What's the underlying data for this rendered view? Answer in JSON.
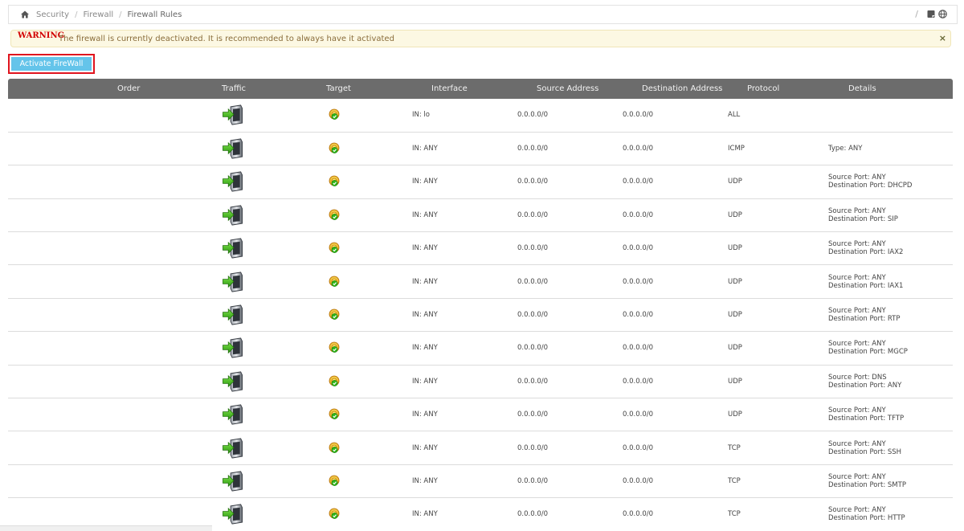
{
  "breadcrumb": {
    "items": [
      "Security",
      "Firewall",
      "Firewall Rules"
    ],
    "separator": "/"
  },
  "toolbar": {
    "slash": "/",
    "icons": [
      "note-icon",
      "globe-icon"
    ]
  },
  "warning": {
    "label": "WARNING",
    "message": "The firewall is currently deactivated. It is recommended to always have it activated",
    "close": "×"
  },
  "activate_button": {
    "label": "Activate FireWall"
  },
  "table": {
    "headers": [
      "Order",
      "Traffic",
      "Target",
      "Interface",
      "Source Address",
      "Destination Address",
      "Protocol",
      "Details"
    ],
    "rows": [
      {
        "interface": "IN: lo",
        "source": "0.0.0.0/0",
        "destination": "0.0.0.0/0",
        "protocol": "ALL",
        "details": []
      },
      {
        "interface": "IN: ANY",
        "source": "0.0.0.0/0",
        "destination": "0.0.0.0/0",
        "protocol": "ICMP",
        "details": [
          "Type: ANY"
        ]
      },
      {
        "interface": "IN: ANY",
        "source": "0.0.0.0/0",
        "destination": "0.0.0.0/0",
        "protocol": "UDP",
        "details": [
          "Source Port: ANY",
          "Destination Port: DHCPD"
        ]
      },
      {
        "interface": "IN: ANY",
        "source": "0.0.0.0/0",
        "destination": "0.0.0.0/0",
        "protocol": "UDP",
        "details": [
          "Source Port: ANY",
          "Destination Port: SIP"
        ]
      },
      {
        "interface": "IN: ANY",
        "source": "0.0.0.0/0",
        "destination": "0.0.0.0/0",
        "protocol": "UDP",
        "details": [
          "Source Port: ANY",
          "Destination Port: IAX2"
        ]
      },
      {
        "interface": "IN: ANY",
        "source": "0.0.0.0/0",
        "destination": "0.0.0.0/0",
        "protocol": "UDP",
        "details": [
          "Source Port: ANY",
          "Destination Port: IAX1"
        ]
      },
      {
        "interface": "IN: ANY",
        "source": "0.0.0.0/0",
        "destination": "0.0.0.0/0",
        "protocol": "UDP",
        "details": [
          "Source Port: ANY",
          "Destination Port: RTP"
        ]
      },
      {
        "interface": "IN: ANY",
        "source": "0.0.0.0/0",
        "destination": "0.0.0.0/0",
        "protocol": "UDP",
        "details": [
          "Source Port: ANY",
          "Destination Port: MGCP"
        ]
      },
      {
        "interface": "IN: ANY",
        "source": "0.0.0.0/0",
        "destination": "0.0.0.0/0",
        "protocol": "UDP",
        "details": [
          "Source Port: DNS",
          "Destination Port: ANY"
        ]
      },
      {
        "interface": "IN: ANY",
        "source": "0.0.0.0/0",
        "destination": "0.0.0.0/0",
        "protocol": "UDP",
        "details": [
          "Source Port: ANY",
          "Destination Port: TFTP"
        ]
      },
      {
        "interface": "IN: ANY",
        "source": "0.0.0.0/0",
        "destination": "0.0.0.0/0",
        "protocol": "TCP",
        "details": [
          "Source Port: ANY",
          "Destination Port: SSH"
        ]
      },
      {
        "interface": "IN: ANY",
        "source": "0.0.0.0/0",
        "destination": "0.0.0.0/0",
        "protocol": "TCP",
        "details": [
          "Source Port: ANY",
          "Destination Port: SMTP"
        ]
      },
      {
        "interface": "IN: ANY",
        "source": "0.0.0.0/0",
        "destination": "0.0.0.0/0",
        "protocol": "TCP",
        "details": [
          "Source Port: ANY",
          "Destination Port: HTTP"
        ]
      }
    ]
  },
  "colors": {
    "header_bg": "#6c6c6c",
    "button_bg": "#64c4ea",
    "button_border": "#e0141e",
    "warning_bg": "#fcf8e3",
    "warning_label": "#d20000",
    "warning_text": "#8a6d3b"
  }
}
